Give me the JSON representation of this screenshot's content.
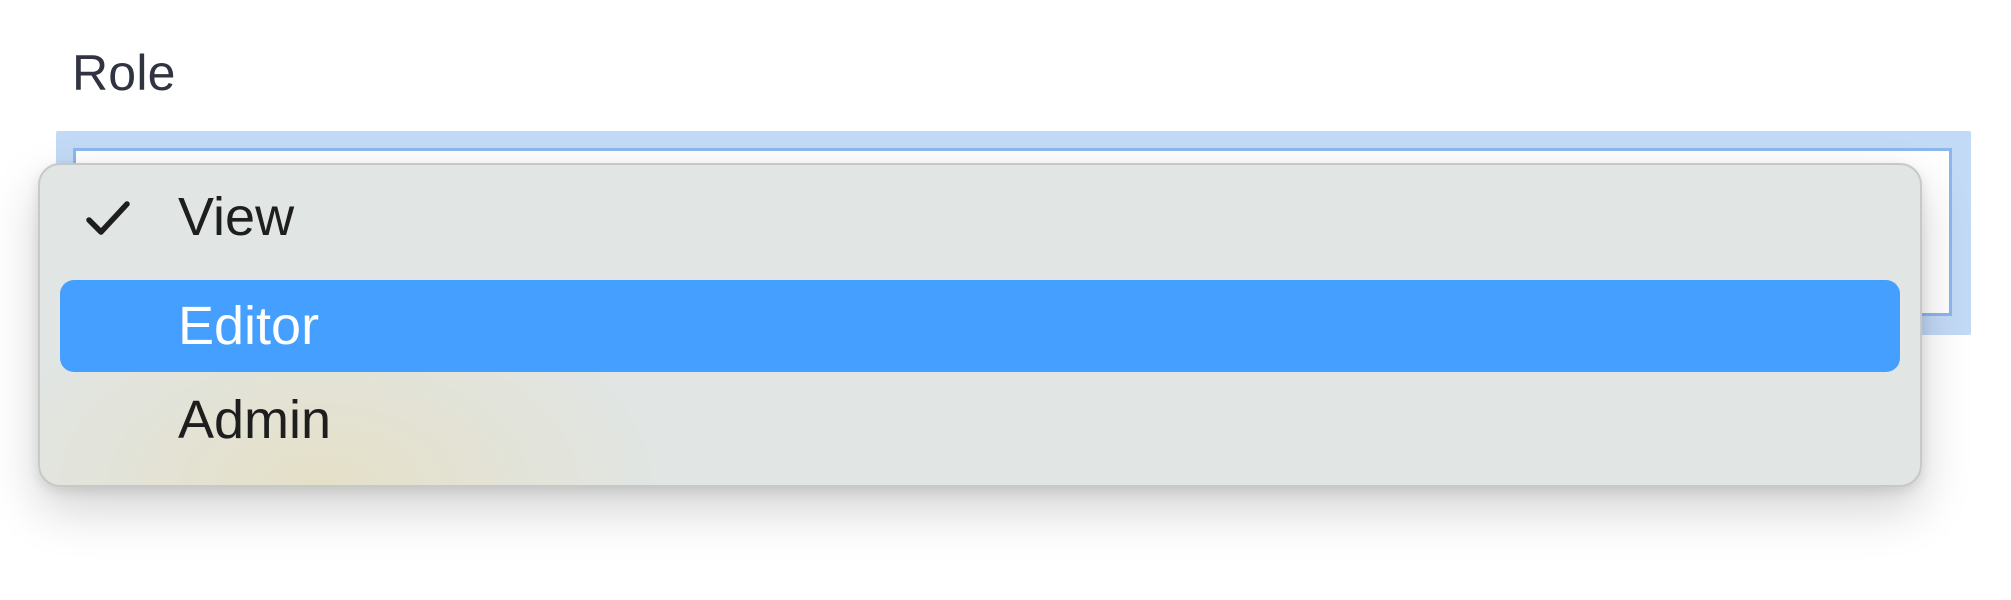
{
  "field": {
    "label": "Role"
  },
  "select": {
    "selected_value": "View",
    "highlighted_value": "Editor",
    "options": [
      {
        "label": "View",
        "checked": true,
        "highlighted": false
      },
      {
        "label": "Editor",
        "checked": false,
        "highlighted": true
      },
      {
        "label": "Admin",
        "checked": false,
        "highlighted": false
      }
    ]
  },
  "colors": {
    "highlight": "#459ffe",
    "menu_background": "#e1e5e3",
    "focus_ring": "#c3daf7",
    "label_text": "#2f3440"
  },
  "icons": {
    "checkmark": "checkmark-icon"
  }
}
